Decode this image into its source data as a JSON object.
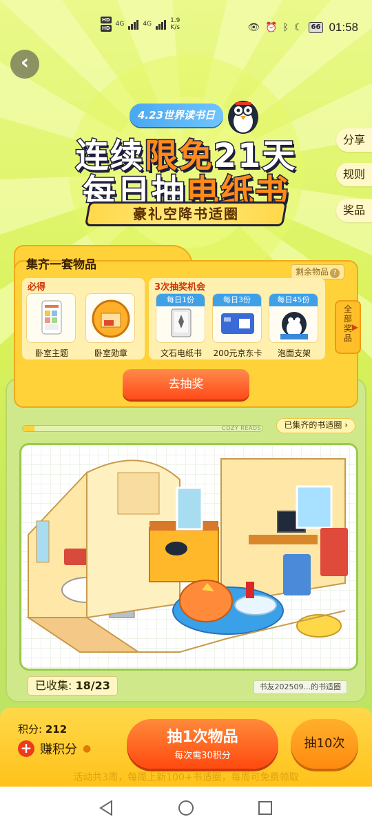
{
  "status_bar": {
    "hd1": "HD",
    "hd2": "HD",
    "net1": "4G",
    "net2": "4G",
    "speed_value": "1.9",
    "speed_unit": "K/s",
    "battery": "66",
    "time": "01:58"
  },
  "hero": {
    "badge": "4.23世界读书日",
    "line1_a": "连续",
    "line1_b": "限免",
    "line1_c": "21天",
    "line2_a": "每日抽",
    "line2_b": "电纸书",
    "ribbon": "豪礼空降书适圈"
  },
  "side_menu": {
    "share": "分享",
    "rules": "规则",
    "prizes": "奖品"
  },
  "collect": {
    "title": "集齐一套物品",
    "remaining_label": "剩余物品",
    "must_label": "必得",
    "must_items": [
      {
        "name": "卧室主题"
      },
      {
        "name": "卧室勋章"
      }
    ],
    "lottery_label": "3次抽奖机会",
    "lottery_items": [
      {
        "tag": "每日1份",
        "name": "文石电纸书"
      },
      {
        "tag": "每日3份",
        "name": "200元京东卡"
      },
      {
        "tag": "每日45份",
        "name": "泡面支架"
      }
    ],
    "all_prizes_label": "全部奖品",
    "go_draw_label": "去抽奖"
  },
  "room": {
    "progress": 0.05,
    "cozy_text": "COZY READS",
    "collected_rooms_label": "已集齐的书适圈 ›",
    "collected_label": "已收集:",
    "collected_value": "18/23",
    "owner_label": "书友202509...的书适圈"
  },
  "bottom": {
    "points_label": "积分:",
    "points_value": "212",
    "earn_label": "赚积分",
    "draw1_main": "抽1次物品",
    "draw1_sub": "每次需30积分",
    "draw10_label": "抽10次",
    "ticker": "活动共3周，每周上新100+书适圈，每周可免费领取"
  },
  "colors": {
    "accent": "#ff4a10",
    "brand_yellow": "#ffd23a",
    "green": "#cfe98a"
  }
}
